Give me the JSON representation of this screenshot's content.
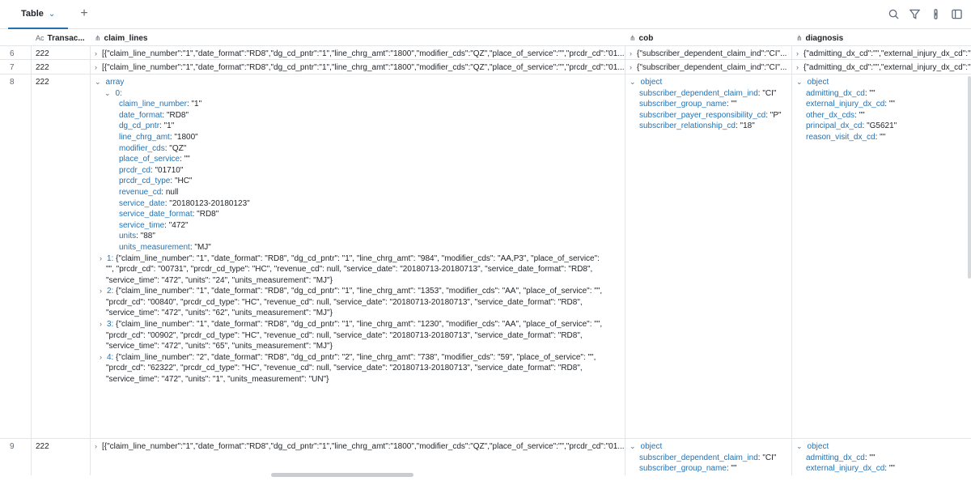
{
  "toolbar": {
    "tab_label": "Table",
    "add_tab_symbol": "+",
    "icons": [
      "search-icon",
      "filter-icon",
      "more-vertical-icon",
      "panel-icon"
    ]
  },
  "columns": [
    {
      "name": "",
      "type": ""
    },
    {
      "name": "Transac...",
      "type": "Aᴄ"
    },
    {
      "name": "claim_lines",
      "type": "struct"
    },
    {
      "name": "cob",
      "type": "struct"
    },
    {
      "name": "diagnosis",
      "type": "struct"
    }
  ],
  "rows": {
    "r6": {
      "num": "6",
      "trans": "222",
      "claim": "[{\"claim_line_number\":\"1\",\"date_format\":\"RD8\",\"dg_cd_pntr\":\"1\",\"line_chrg_amt\":\"1800\",\"modifier_cds\":\"QZ\",\"place_of_service\":\"\",\"prcdr_cd\":\"01...",
      "cob": "{\"subscriber_dependent_claim_ind\":\"CI\"...",
      "diag": "{\"admitting_dx_cd\":\"\",\"external_injury_dx_cd\":\""
    },
    "r7": {
      "num": "7",
      "trans": "222",
      "claim": "[{\"claim_line_number\":\"1\",\"date_format\":\"RD8\",\"dg_cd_pntr\":\"1\",\"line_chrg_amt\":\"1800\",\"modifier_cds\":\"QZ\",\"place_of_service\":\"\",\"prcdr_cd\":\"01...",
      "cob": "{\"subscriber_dependent_claim_ind\":\"CI\"...",
      "diag": "{\"admitting_dx_cd\":\"\",\"external_injury_dx_cd\":\""
    },
    "r8": {
      "num": "8",
      "trans": "222",
      "array_label": "array",
      "item0_label": "0:",
      "item0_fields": [
        {
          "k": "claim_line_number",
          "v": "\"1\""
        },
        {
          "k": "date_format",
          "v": "\"RD8\""
        },
        {
          "k": "dg_cd_pntr",
          "v": "\"1\""
        },
        {
          "k": "line_chrg_amt",
          "v": "\"1800\""
        },
        {
          "k": "modifier_cds",
          "v": "\"QZ\""
        },
        {
          "k": "place_of_service",
          "v": "\"\""
        },
        {
          "k": "prcdr_cd",
          "v": "\"01710\""
        },
        {
          "k": "prcdr_cd_type",
          "v": "\"HC\""
        },
        {
          "k": "revenue_cd",
          "v": "null"
        },
        {
          "k": "service_date",
          "v": "\"20180123-20180123\""
        },
        {
          "k": "service_date_format",
          "v": "\"RD8\""
        },
        {
          "k": "service_time",
          "v": "\"472\""
        },
        {
          "k": "units",
          "v": "\"88\""
        },
        {
          "k": "units_measurement",
          "v": "\"MJ\""
        }
      ],
      "collapsed_items": [
        {
          "idx": "1:",
          "text": "{\"claim_line_number\": \"1\", \"date_format\": \"RD8\", \"dg_cd_pntr\": \"1\", \"line_chrg_amt\": \"984\", \"modifier_cds\": \"AA,P3\", \"place_of_service\": \"\", \"prcdr_cd\": \"00731\", \"prcdr_cd_type\": \"HC\", \"revenue_cd\": null, \"service_date\": \"20180713-20180713\", \"service_date_format\": \"RD8\", \"service_time\": \"472\", \"units\": \"24\", \"units_measurement\": \"MJ\"}"
        },
        {
          "idx": "2:",
          "text": "{\"claim_line_number\": \"1\", \"date_format\": \"RD8\", \"dg_cd_pntr\": \"1\", \"line_chrg_amt\": \"1353\", \"modifier_cds\": \"AA\", \"place_of_service\": \"\", \"prcdr_cd\": \"00840\", \"prcdr_cd_type\": \"HC\", \"revenue_cd\": null, \"service_date\": \"20180713-20180713\", \"service_date_format\": \"RD8\", \"service_time\": \"472\", \"units\": \"62\", \"units_measurement\": \"MJ\"}"
        },
        {
          "idx": "3:",
          "text": "{\"claim_line_number\": \"1\", \"date_format\": \"RD8\", \"dg_cd_pntr\": \"1\", \"line_chrg_amt\": \"1230\", \"modifier_cds\": \"AA\", \"place_of_service\": \"\", \"prcdr_cd\": \"00902\", \"prcdr_cd_type\": \"HC\", \"revenue_cd\": null, \"service_date\": \"20180713-20180713\", \"service_date_format\": \"RD8\", \"service_time\": \"472\", \"units\": \"65\", \"units_measurement\": \"MJ\"}"
        },
        {
          "idx": "4:",
          "text": "{\"claim_line_number\": \"2\", \"date_format\": \"RD8\", \"dg_cd_pntr\": \"2\", \"line_chrg_amt\": \"738\", \"modifier_cds\": \"59\", \"place_of_service\": \"\", \"prcdr_cd\": \"62322\", \"prcdr_cd_type\": \"HC\", \"revenue_cd\": null, \"service_date\": \"20180713-20180713\", \"service_date_format\": \"RD8\", \"service_time\": \"472\", \"units\": \"1\", \"units_measurement\": \"UN\"}"
        }
      ],
      "cob_label": "object",
      "cob_fields": [
        {
          "k": "subscriber_dependent_claim_ind",
          "v": "\"CI\""
        },
        {
          "k": "subscriber_group_name",
          "v": "\"\""
        },
        {
          "k": "subscriber_payer_responsibility_cd",
          "v": "\"P\""
        },
        {
          "k": "subscriber_relationship_cd",
          "v": "\"18\""
        }
      ],
      "diag_label": "object",
      "diag_fields": [
        {
          "k": "admitting_dx_cd",
          "v": "\"\""
        },
        {
          "k": "external_injury_dx_cd",
          "v": "\"\""
        },
        {
          "k": "other_dx_cds",
          "v": "\"\""
        },
        {
          "k": "principal_dx_cd",
          "v": "\"G5621\""
        },
        {
          "k": "reason_visit_dx_cd",
          "v": "\"\""
        }
      ]
    },
    "r9": {
      "num": "9",
      "trans": "222",
      "claim": "[{\"claim_line_number\":\"1\",\"date_format\":\"RD8\",\"dg_cd_pntr\":\"1\",\"line_chrg_amt\":\"1800\",\"modifier_cds\":\"QZ\",\"place_of_service\":\"\",\"prcdr_cd\":\"01...",
      "cob_label": "object",
      "cob_fields": [
        {
          "k": "subscriber_dependent_claim_ind",
          "v": "\"CI\""
        },
        {
          "k": "subscriber_group_name",
          "v": "\"\""
        }
      ],
      "diag_label": "object",
      "diag_fields": [
        {
          "k": "admitting_dx_cd",
          "v": "\"\""
        },
        {
          "k": "external_injury_dx_cd",
          "v": "\"\""
        }
      ]
    }
  }
}
